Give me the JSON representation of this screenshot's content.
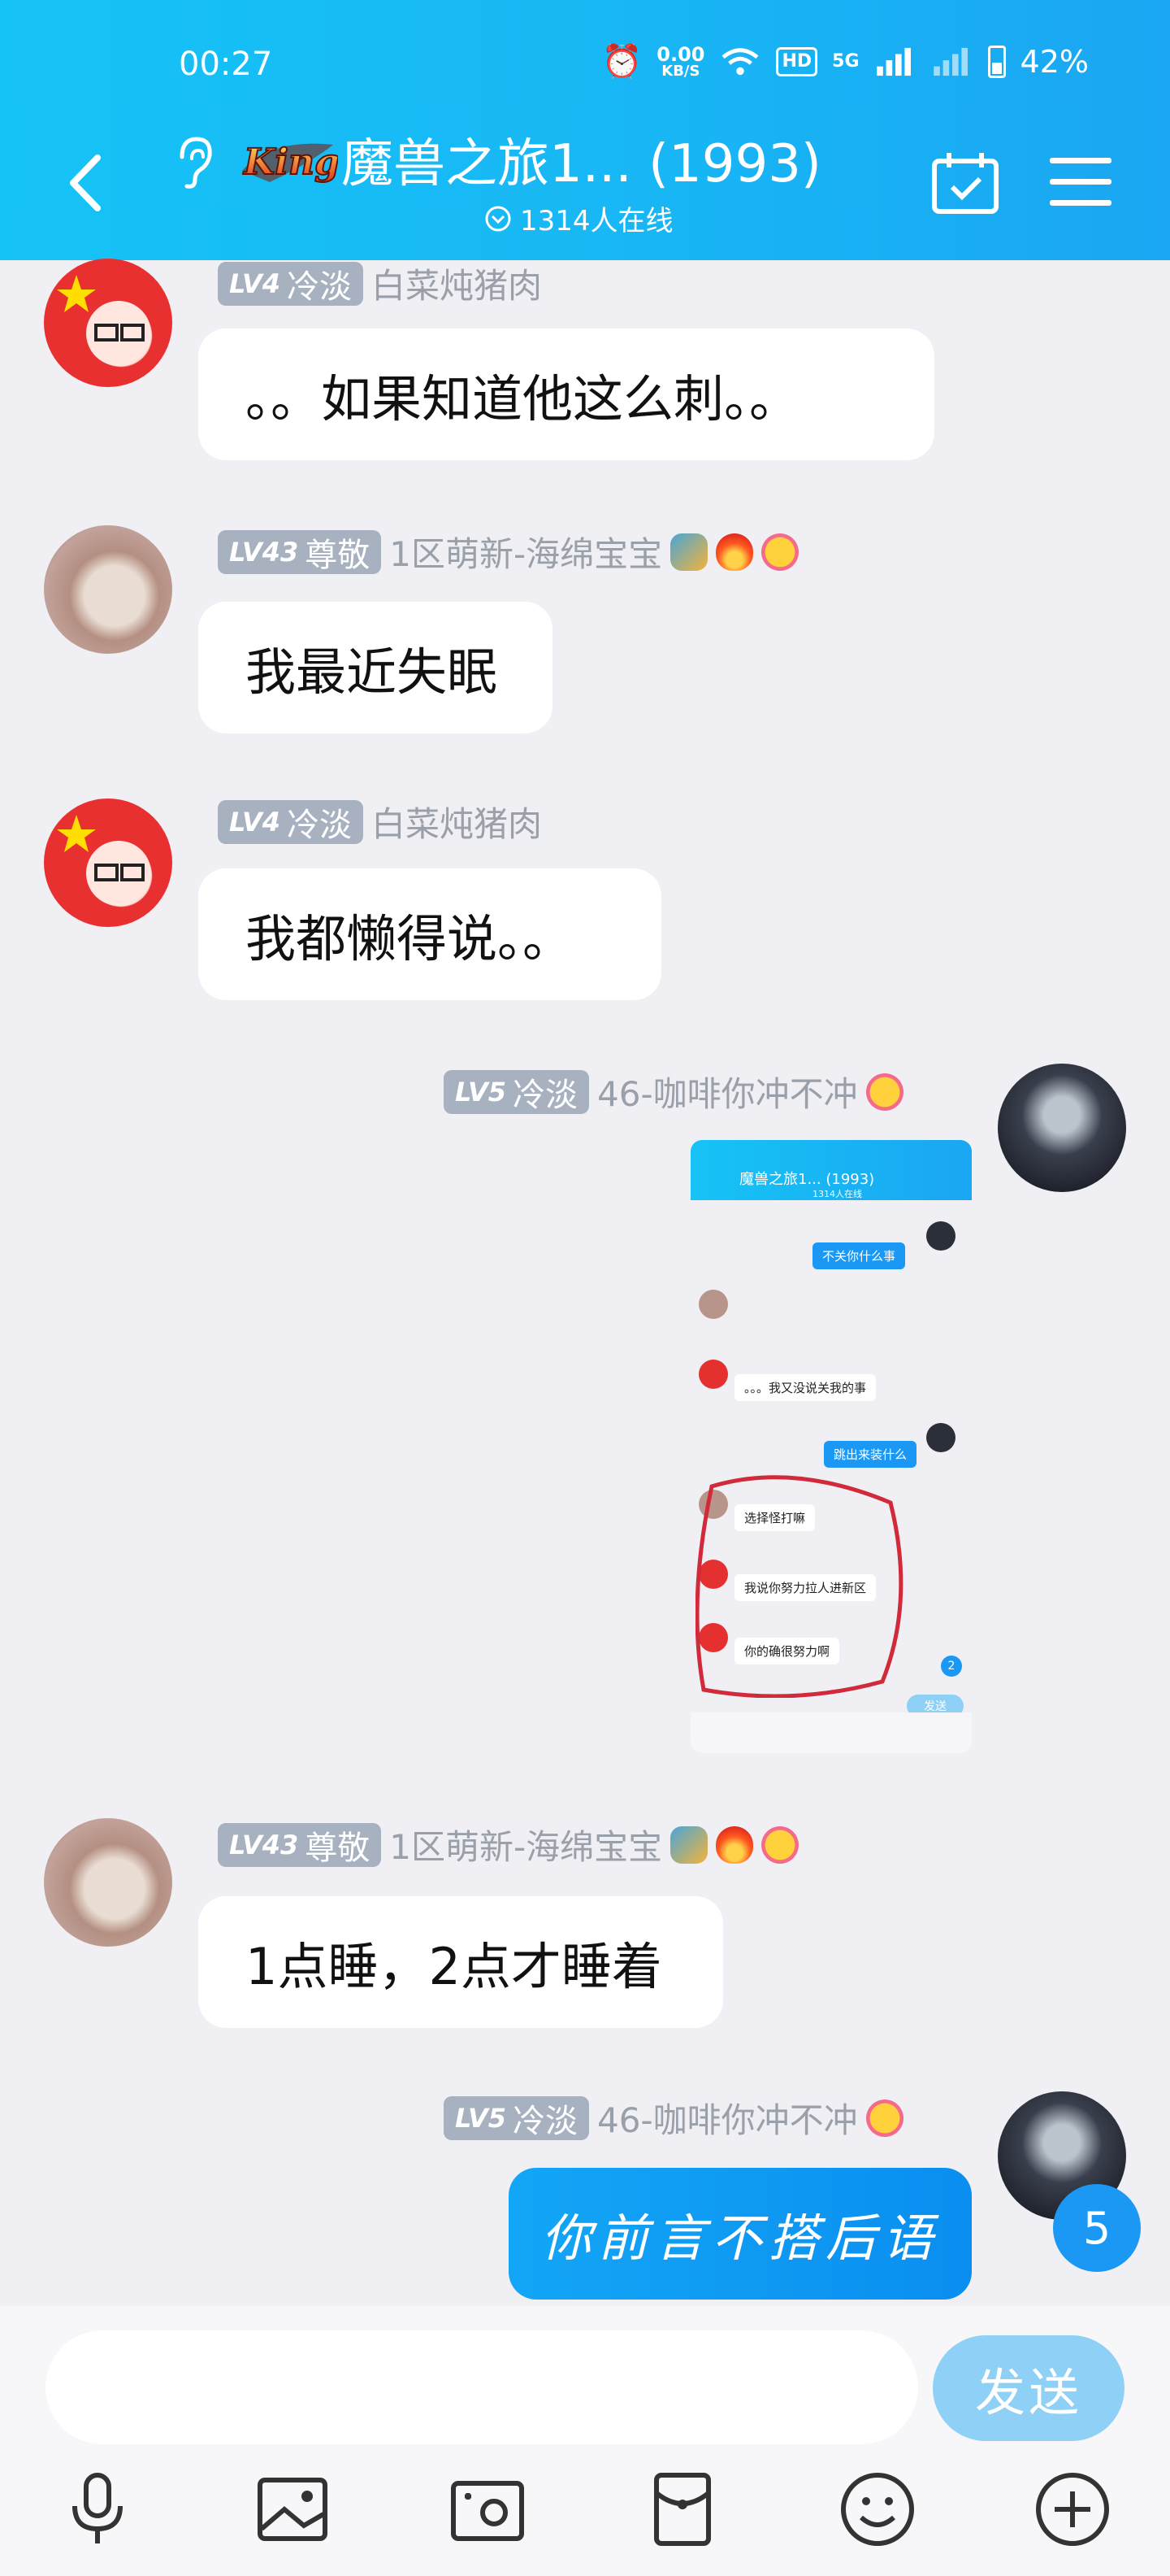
{
  "status_bar": {
    "time": "00:27",
    "net_speed": "0.00",
    "net_unit": "KB/S",
    "hd": "HD",
    "signal_label": "5G",
    "battery": "42%",
    "battery_level": 0.42
  },
  "header": {
    "group_title": "魔兽之旅1... (1993)",
    "online_text": "1314人在线",
    "logo_text": "King"
  },
  "messages": [
    {
      "level": "LV4",
      "title": "冷淡",
      "name": "白菜炖猪肉",
      "text": "。。如果知道他这么刺。。"
    },
    {
      "level": "LV43",
      "title": "尊敬",
      "name": "1区萌新-海绵宝宝",
      "text": "我最近失眠"
    },
    {
      "level": "LV4",
      "title": "冷淡",
      "name": "白菜炖猪肉",
      "text": "我都懒得说。。"
    },
    {
      "level": "LV5",
      "title": "冷淡",
      "name": "46-咖啡你冲不冲"
    },
    {
      "level": "LV43",
      "title": "尊敬",
      "name": "1区萌新-海绵宝宝",
      "text": "1点睡，2点才睡着"
    },
    {
      "level": "LV5",
      "title": "冷淡",
      "name": "46-咖啡你冲不冲",
      "text": "你前言不搭后语"
    }
  ],
  "screenshot_thumb": {
    "title": "魔兽之旅1... (1993)",
    "online": "1314人在线",
    "lines": [
      "不关你什么事",
      "。。。我又没说关我的事",
      "跳出来装什么",
      "选择怪打嘛",
      "我说你努力拉人进新区",
      "你的确很努力啊"
    ],
    "send": "发送",
    "badge": "2"
  },
  "unread_count": "5",
  "input": {
    "value": "",
    "send_label": "发送"
  },
  "toolbar_icons": [
    "microphone-icon",
    "image-icon",
    "camera-icon",
    "red-packet-icon",
    "emoji-icon",
    "plus-icon"
  ]
}
